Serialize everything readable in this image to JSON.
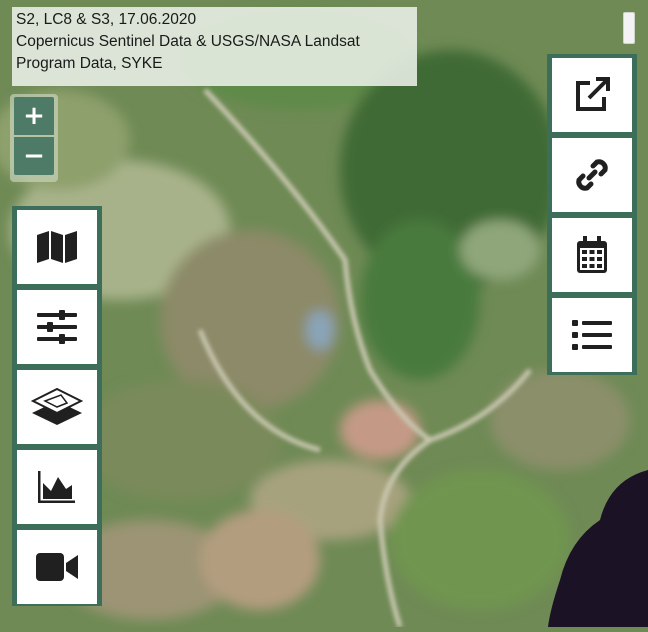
{
  "attribution": {
    "line1": "S2, LC8 & S3, 17.06.2020",
    "line2": "Copernicus Sentinel Data & USGS/NASA Landsat",
    "line3": "Program Data, SYKE"
  },
  "zoom": {
    "in_label": "+",
    "out_label": "−"
  },
  "left_tools": [
    {
      "icon": "map-icon"
    },
    {
      "icon": "sliders-icon"
    },
    {
      "icon": "layers-icon"
    },
    {
      "icon": "area-chart-icon"
    },
    {
      "icon": "video-camera-icon"
    }
  ],
  "right_tools": [
    {
      "icon": "external-link-icon"
    },
    {
      "icon": "link-icon"
    },
    {
      "icon": "calendar-icon"
    },
    {
      "icon": "list-icon"
    }
  ],
  "colors": {
    "panel": "#3d6e5a",
    "zoom_button": "#4e7b68",
    "water": "#1c1225"
  }
}
